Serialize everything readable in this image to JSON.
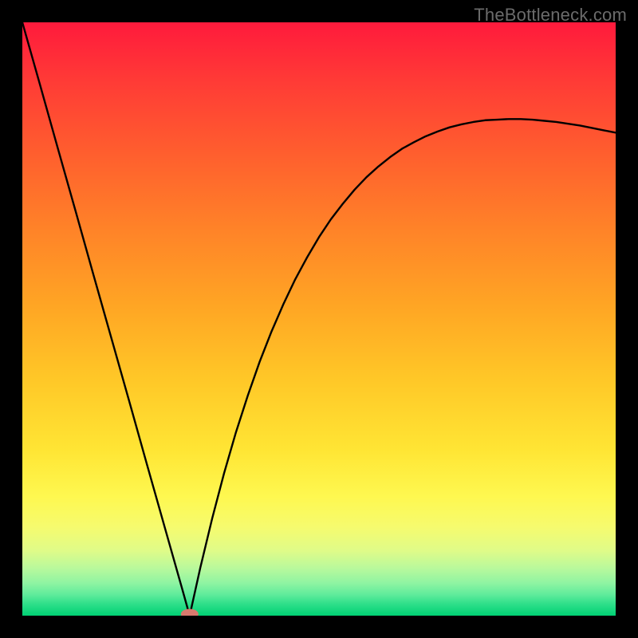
{
  "watermark": "TheBottleneck.com",
  "chart_data": {
    "type": "line",
    "title": "",
    "xlabel": "",
    "ylabel": "",
    "xlim": [
      0,
      1
    ],
    "ylim": [
      0,
      1
    ],
    "curve_left": {
      "x": [
        0.0,
        0.03,
        0.06,
        0.09,
        0.12,
        0.15,
        0.18,
        0.21,
        0.24,
        0.27,
        0.282
      ],
      "y": [
        1.0,
        0.894,
        0.787,
        0.681,
        0.574,
        0.468,
        0.362,
        0.255,
        0.149,
        0.043,
        0.0
      ]
    },
    "curve_right": {
      "x": [
        0.282,
        0.3,
        0.32,
        0.34,
        0.36,
        0.38,
        0.4,
        0.42,
        0.44,
        0.46,
        0.48,
        0.5,
        0.52,
        0.54,
        0.56,
        0.58,
        0.6,
        0.62,
        0.64,
        0.66,
        0.68,
        0.7,
        0.72,
        0.74,
        0.76,
        0.78,
        0.8,
        0.82,
        0.84,
        0.86,
        0.88,
        0.9,
        0.92,
        0.94,
        0.96,
        0.98,
        1.0
      ],
      "y": [
        0.0,
        0.081,
        0.164,
        0.24,
        0.309,
        0.371,
        0.428,
        0.479,
        0.525,
        0.567,
        0.604,
        0.638,
        0.668,
        0.694,
        0.718,
        0.739,
        0.757,
        0.773,
        0.787,
        0.798,
        0.808,
        0.816,
        0.823,
        0.828,
        0.832,
        0.835,
        0.836,
        0.837,
        0.837,
        0.836,
        0.834,
        0.832,
        0.829,
        0.826,
        0.822,
        0.818,
        0.814
      ]
    },
    "min_marker": {
      "x": 0.282,
      "y": 0.0
    },
    "gradient_stops": [
      {
        "offset": 0.0,
        "color": "#ff1a3c"
      },
      {
        "offset": 0.1,
        "color": "#ff3b36"
      },
      {
        "offset": 0.22,
        "color": "#ff5e2e"
      },
      {
        "offset": 0.35,
        "color": "#ff8328"
      },
      {
        "offset": 0.48,
        "color": "#ffa624"
      },
      {
        "offset": 0.6,
        "color": "#ffc727"
      },
      {
        "offset": 0.72,
        "color": "#ffe534"
      },
      {
        "offset": 0.8,
        "color": "#fef850"
      },
      {
        "offset": 0.85,
        "color": "#f6fb6e"
      },
      {
        "offset": 0.89,
        "color": "#e0fb88"
      },
      {
        "offset": 0.92,
        "color": "#b9f99c"
      },
      {
        "offset": 0.945,
        "color": "#8ff4a2"
      },
      {
        "offset": 0.965,
        "color": "#5eeb9b"
      },
      {
        "offset": 0.98,
        "color": "#2fdf8a"
      },
      {
        "offset": 1.0,
        "color": "#00d174"
      }
    ]
  }
}
